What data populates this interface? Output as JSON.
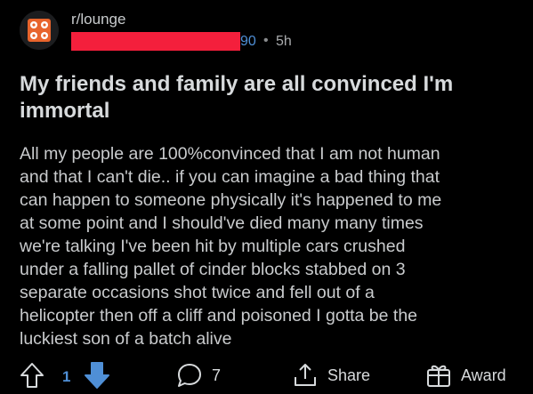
{
  "post": {
    "subreddit": "r/lounge",
    "username_suffix": "90",
    "separator": "•",
    "age": "5h",
    "title": "My friends and family are all convinced I'm immortal",
    "body": "All my people are 100%convinced that I am not human\nand that I can't die.. if you can imagine a bad thing that\ncan happen to someone physically it's happened to me\nat some point and I should've died many many times\nwe're talking I've been hit by multiple cars crushed\nunder a falling pallet of cinder blocks stabbed on 3\nseparate occasions shot twice and fell out of a\nhelicopter then off a cliff and poisoned I gotta be the\nluckiest son of a batch alive"
  },
  "actions": {
    "vote_count": "1",
    "comment_count": "7",
    "share_label": "Share",
    "award_label": "Award"
  },
  "colors": {
    "background": "#000000",
    "redaction": "#f41f3c",
    "downvote_active": "#4f8fd6",
    "text": "#d7dadc"
  },
  "icons": {
    "subreddit_avatar": "subreddit-avatar-icon",
    "upvote": "upvote-arrow-icon",
    "downvote": "downvote-arrow-icon",
    "comment": "comment-bubble-icon",
    "share": "share-icon",
    "award": "award-gift-icon"
  }
}
